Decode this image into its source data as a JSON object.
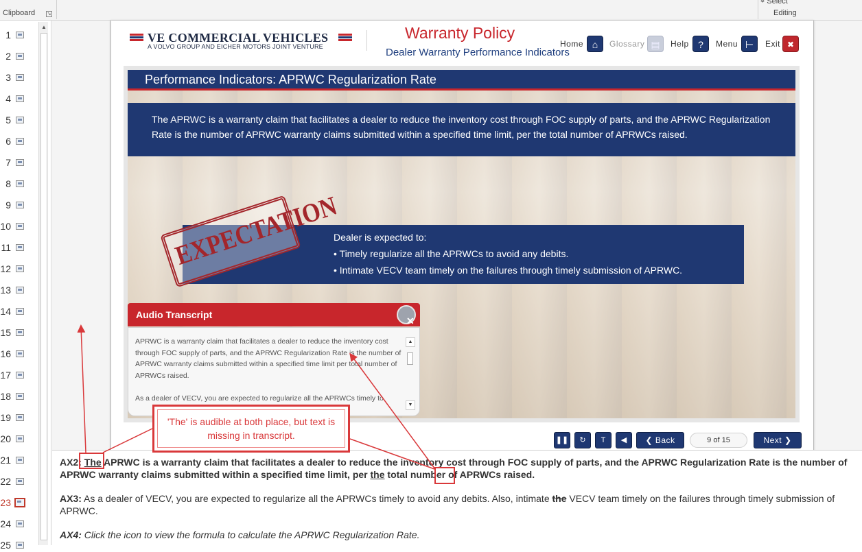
{
  "ribbon": {
    "clipboard": "Clipboard",
    "editing": "Editing",
    "select": "Select"
  },
  "thumbnails": {
    "items": [
      "1",
      "2",
      "3",
      "4",
      "5",
      "6",
      "7",
      "8",
      "9",
      "10",
      "11",
      "12",
      "13",
      "14",
      "15",
      "16",
      "17",
      "18",
      "19",
      "20",
      "21",
      "22",
      "23",
      "24",
      "25"
    ],
    "active": "23"
  },
  "slide": {
    "logo": "VE COMMERCIAL VEHICLES",
    "logo_sub": "A VOLVO GROUP AND EICHER MOTORS JOINT VENTURE",
    "course_title": "Warranty Policy",
    "course_subtitle": "Dealer Warranty Performance Indicators",
    "nav": {
      "home": "Home",
      "glossary": "Glossary",
      "help": "Help",
      "help_icon": "?",
      "menu": "Menu",
      "exit": "Exit"
    },
    "page_title": "Performance Indicators: APRWC Regularization Rate",
    "intro": "The APRWC is a warranty claim that facilitates a dealer to reduce the inventory cost through FOC supply of parts, and the APRWC Regularization Rate is the number of APRWC warranty claims submitted within a specified time limit, per the total number of APRWCs raised.",
    "stamp": "EXPECTATION",
    "expect_lead": "Dealer is expected to:",
    "expect_bullets": [
      "• Timely regularize all the APRWCs to avoid any debits.",
      "• Intimate VECV team timely on the failures through timely submission of APRWC."
    ],
    "transcript": {
      "title": "Audio Transcript",
      "para1": "APRWC is a warranty claim that facilitates a dealer to reduce the inventory cost through FOC supply of parts, and the APRWC Regularization Rate is the number of APRWC warranty claims submitted within a specified time limit per total number of APRWCs raised.",
      "para2": "As a dealer of VECV, you are expected to regularize all the APRWCs timely to"
    },
    "footer": {
      "back": "Back",
      "page": "9 of 15",
      "next": "Next"
    }
  },
  "annotation": {
    "callout": "'The' is audible at both place, but text is missing in transcript."
  },
  "notes": {
    "ax2_label": "AX2:",
    "ax2_word": "The",
    "ax2_mid": "APRWC is a warranty claim that facilitates a dealer to reduce the inventory cost through FOC supply of parts, and the APRWC Regularization Rate is the number of APRWC warranty claims submitted within a specified time limit, per",
    "ax2_the": "the",
    "ax2_end": "total number of APRWCs raised.",
    "ax3_label": "AX3:",
    "ax3_a": "As a dealer of VECV, you are expected to regularize all the APRWCs timely to avoid any debits. Also, intimate",
    "ax3_strike": "the",
    "ax3_b": "VECV team timely on the failures through timely submission of APRWC.",
    "ax4_label": "AX4:",
    "ax4_text": "Click the icon to view the formula to calculate the APRWC Regularization Rate."
  },
  "colors": {
    "brand_blue": "#1f3872",
    "brand_red": "#c8262c",
    "annotation_red": "#d9383a"
  }
}
